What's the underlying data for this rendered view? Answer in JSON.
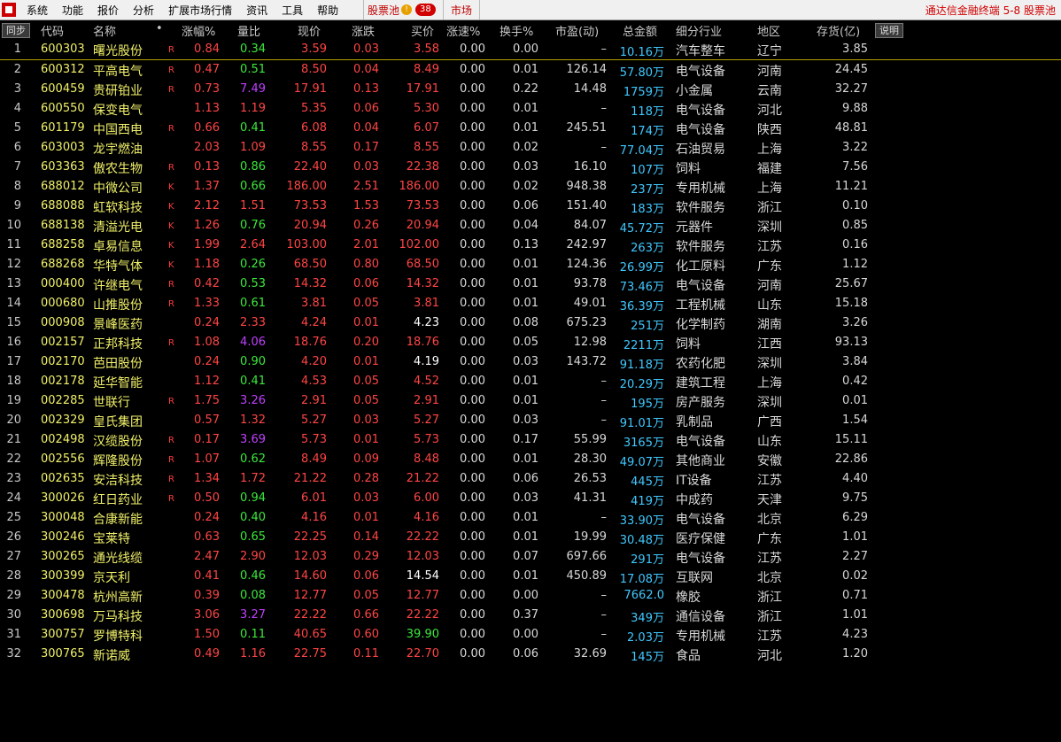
{
  "menubar": {
    "items": [
      "系统",
      "功能",
      "报价",
      "分析",
      "扩展市场行情",
      "资讯",
      "工具",
      "帮助"
    ],
    "pool_label": "股票池",
    "pool_badge": "38",
    "market_label": "市场",
    "title_right": "通达信金融终端  5-8 股票池"
  },
  "header": {
    "sync": "同步",
    "desc": "说明",
    "columns": {
      "code": "代码",
      "name": "名称",
      "dot": "•",
      "pct": "涨幅%",
      "vr": "量比",
      "price": "现价",
      "chg": "涨跌",
      "bid": "买价",
      "spd": "涨速%",
      "turn": "换手%",
      "pe": "市盈(动)",
      "amt": "总金额",
      "ind": "细分行业",
      "reg": "地区",
      "inv": "存货(亿)"
    }
  },
  "colors": {
    "red": "#ff4545",
    "green": "#3ce83c",
    "purple": "#c040ff",
    "white": "#ffffff",
    "yellow": "#f0f06a",
    "cyan": "#40c8ff"
  },
  "rows": [
    {
      "idx": "1",
      "code": "600303",
      "name": "曙光股份",
      "flag": "R",
      "pct": "0.84",
      "vr": "0.34",
      "vrc": "green",
      "price": "3.59",
      "chg": "0.03",
      "bid": "3.58",
      "bidc": "red",
      "spd": "0.00",
      "turn": "0.00",
      "pe": "–",
      "amt": "10.16",
      "unit": "万",
      "ind": "汽车整车",
      "reg": "辽宁",
      "inv": "3.85"
    },
    {
      "idx": "2",
      "code": "600312",
      "name": "平高电气",
      "flag": "R",
      "pct": "0.47",
      "vr": "0.51",
      "vrc": "green",
      "price": "8.50",
      "chg": "0.04",
      "bid": "8.49",
      "bidc": "red",
      "spd": "0.00",
      "turn": "0.01",
      "pe": "126.14",
      "amt": "57.80",
      "unit": "万",
      "ind": "电气设备",
      "reg": "河南",
      "inv": "24.45"
    },
    {
      "idx": "3",
      "code": "600459",
      "name": "贵研铂业",
      "flag": "R",
      "pct": "0.73",
      "vr": "7.49",
      "vrc": "purple",
      "price": "17.91",
      "chg": "0.13",
      "bid": "17.91",
      "bidc": "red",
      "spd": "0.00",
      "turn": "0.22",
      "pe": "14.48",
      "amt": "1759",
      "unit": "万",
      "ind": "小金属",
      "reg": "云南",
      "inv": "32.27"
    },
    {
      "idx": "4",
      "code": "600550",
      "name": "保变电气",
      "flag": "",
      "pct": "1.13",
      "vr": "1.19",
      "vrc": "red",
      "price": "5.35",
      "chg": "0.06",
      "bid": "5.30",
      "bidc": "red",
      "spd": "0.00",
      "turn": "0.01",
      "pe": "–",
      "amt": "118",
      "unit": "万",
      "ind": "电气设备",
      "reg": "河北",
      "inv": "9.88"
    },
    {
      "idx": "5",
      "code": "601179",
      "name": "中国西电",
      "flag": "R",
      "pct": "0.66",
      "vr": "0.41",
      "vrc": "green",
      "price": "6.08",
      "chg": "0.04",
      "bid": "6.07",
      "bidc": "red",
      "spd": "0.00",
      "turn": "0.01",
      "pe": "245.51",
      "amt": "174",
      "unit": "万",
      "ind": "电气设备",
      "reg": "陕西",
      "inv": "48.81"
    },
    {
      "idx": "6",
      "code": "603003",
      "name": "龙宇燃油",
      "flag": "",
      "pct": "2.03",
      "vr": "1.09",
      "vrc": "red",
      "price": "8.55",
      "chg": "0.17",
      "bid": "8.55",
      "bidc": "red",
      "spd": "0.00",
      "turn": "0.02",
      "pe": "–",
      "amt": "77.04",
      "unit": "万",
      "ind": "石油贸易",
      "reg": "上海",
      "inv": "3.22"
    },
    {
      "idx": "7",
      "code": "603363",
      "name": "傲农生物",
      "flag": "R",
      "pct": "0.13",
      "vr": "0.86",
      "vrc": "green",
      "price": "22.40",
      "chg": "0.03",
      "bid": "22.38",
      "bidc": "red",
      "spd": "0.00",
      "turn": "0.03",
      "pe": "16.10",
      "amt": "107",
      "unit": "万",
      "ind": "饲料",
      "reg": "福建",
      "inv": "7.56"
    },
    {
      "idx": "8",
      "code": "688012",
      "name": "中微公司",
      "flag": "K",
      "pct": "1.37",
      "vr": "0.66",
      "vrc": "green",
      "price": "186.00",
      "chg": "2.51",
      "bid": "186.00",
      "bidc": "red",
      "spd": "0.00",
      "turn": "0.02",
      "pe": "948.38",
      "amt": "237",
      "unit": "万",
      "ind": "专用机械",
      "reg": "上海",
      "inv": "11.21"
    },
    {
      "idx": "9",
      "code": "688088",
      "name": "虹软科技",
      "flag": "K",
      "pct": "2.12",
      "vr": "1.51",
      "vrc": "red",
      "price": "73.53",
      "chg": "1.53",
      "bid": "73.53",
      "bidc": "red",
      "spd": "0.00",
      "turn": "0.06",
      "pe": "151.40",
      "amt": "183",
      "unit": "万",
      "ind": "软件服务",
      "reg": "浙江",
      "inv": "0.10"
    },
    {
      "idx": "10",
      "code": "688138",
      "name": "清溢光电",
      "flag": "K",
      "pct": "1.26",
      "vr": "0.76",
      "vrc": "green",
      "price": "20.94",
      "chg": "0.26",
      "bid": "20.94",
      "bidc": "red",
      "spd": "0.00",
      "turn": "0.04",
      "pe": "84.07",
      "amt": "45.72",
      "unit": "万",
      "ind": "元器件",
      "reg": "深圳",
      "inv": "0.85"
    },
    {
      "idx": "11",
      "code": "688258",
      "name": "卓易信息",
      "flag": "K",
      "pct": "1.99",
      "vr": "2.64",
      "vrc": "red",
      "price": "103.00",
      "chg": "2.01",
      "bid": "102.00",
      "bidc": "red",
      "spd": "0.00",
      "turn": "0.13",
      "pe": "242.97",
      "amt": "263",
      "unit": "万",
      "ind": "软件服务",
      "reg": "江苏",
      "inv": "0.16"
    },
    {
      "idx": "12",
      "code": "688268",
      "name": "华特气体",
      "flag": "K",
      "pct": "1.18",
      "vr": "0.26",
      "vrc": "green",
      "price": "68.50",
      "chg": "0.80",
      "bid": "68.50",
      "bidc": "red",
      "spd": "0.00",
      "turn": "0.01",
      "pe": "124.36",
      "amt": "26.99",
      "unit": "万",
      "ind": "化工原料",
      "reg": "广东",
      "inv": "1.12"
    },
    {
      "idx": "13",
      "code": "000400",
      "name": "许继电气",
      "flag": "R",
      "pct": "0.42",
      "vr": "0.53",
      "vrc": "green",
      "price": "14.32",
      "chg": "0.06",
      "bid": "14.32",
      "bidc": "red",
      "spd": "0.00",
      "turn": "0.01",
      "pe": "93.78",
      "amt": "73.46",
      "unit": "万",
      "ind": "电气设备",
      "reg": "河南",
      "inv": "25.67"
    },
    {
      "idx": "14",
      "code": "000680",
      "name": "山推股份",
      "flag": "R",
      "pct": "1.33",
      "vr": "0.61",
      "vrc": "green",
      "price": "3.81",
      "chg": "0.05",
      "bid": "3.81",
      "bidc": "red",
      "spd": "0.00",
      "turn": "0.01",
      "pe": "49.01",
      "amt": "36.39",
      "unit": "万",
      "ind": "工程机械",
      "reg": "山东",
      "inv": "15.18"
    },
    {
      "idx": "15",
      "code": "000908",
      "name": "景峰医药",
      "flag": "",
      "pct": "0.24",
      "vr": "2.33",
      "vrc": "red",
      "price": "4.24",
      "chg": "0.01",
      "bid": "4.23",
      "bidc": "white",
      "spd": "0.00",
      "turn": "0.08",
      "pe": "675.23",
      "amt": "251",
      "unit": "万",
      "ind": "化学制药",
      "reg": "湖南",
      "inv": "3.26"
    },
    {
      "idx": "16",
      "code": "002157",
      "name": "正邦科技",
      "flag": "R",
      "pct": "1.08",
      "vr": "4.06",
      "vrc": "purple",
      "price": "18.76",
      "chg": "0.20",
      "bid": "18.76",
      "bidc": "red",
      "spd": "0.00",
      "turn": "0.05",
      "pe": "12.98",
      "amt": "2211",
      "unit": "万",
      "ind": "饲料",
      "reg": "江西",
      "inv": "93.13"
    },
    {
      "idx": "17",
      "code": "002170",
      "name": "芭田股份",
      "flag": "",
      "pct": "0.24",
      "vr": "0.90",
      "vrc": "green",
      "price": "4.20",
      "chg": "0.01",
      "bid": "4.19",
      "bidc": "white",
      "spd": "0.00",
      "turn": "0.03",
      "pe": "143.72",
      "amt": "91.18",
      "unit": "万",
      "ind": "农药化肥",
      "reg": "深圳",
      "inv": "3.84"
    },
    {
      "idx": "18",
      "code": "002178",
      "name": "延华智能",
      "flag": "",
      "pct": "1.12",
      "vr": "0.41",
      "vrc": "green",
      "price": "4.53",
      "chg": "0.05",
      "bid": "4.52",
      "bidc": "red",
      "spd": "0.00",
      "turn": "0.01",
      "pe": "–",
      "amt": "20.29",
      "unit": "万",
      "ind": "建筑工程",
      "reg": "上海",
      "inv": "0.42"
    },
    {
      "idx": "19",
      "code": "002285",
      "name": "世联行",
      "flag": "R",
      "pct": "1.75",
      "vr": "3.26",
      "vrc": "purple",
      "price": "2.91",
      "chg": "0.05",
      "bid": "2.91",
      "bidc": "red",
      "spd": "0.00",
      "turn": "0.01",
      "pe": "–",
      "amt": "195",
      "unit": "万",
      "ind": "房产服务",
      "reg": "深圳",
      "inv": "0.01"
    },
    {
      "idx": "20",
      "code": "002329",
      "name": "皇氏集团",
      "flag": "",
      "pct": "0.57",
      "vr": "1.32",
      "vrc": "red",
      "price": "5.27",
      "chg": "0.03",
      "bid": "5.27",
      "bidc": "red",
      "spd": "0.00",
      "turn": "0.03",
      "pe": "–",
      "amt": "91.01",
      "unit": "万",
      "ind": "乳制品",
      "reg": "广西",
      "inv": "1.54"
    },
    {
      "idx": "21",
      "code": "002498",
      "name": "汉缆股份",
      "flag": "R",
      "pct": "0.17",
      "vr": "3.69",
      "vrc": "purple",
      "price": "5.73",
      "chg": "0.01",
      "bid": "5.73",
      "bidc": "red",
      "spd": "0.00",
      "turn": "0.17",
      "pe": "55.99",
      "amt": "3165",
      "unit": "万",
      "ind": "电气设备",
      "reg": "山东",
      "inv": "15.11"
    },
    {
      "idx": "22",
      "code": "002556",
      "name": "辉隆股份",
      "flag": "R",
      "pct": "1.07",
      "vr": "0.62",
      "vrc": "green",
      "price": "8.49",
      "chg": "0.09",
      "bid": "8.48",
      "bidc": "red",
      "spd": "0.00",
      "turn": "0.01",
      "pe": "28.30",
      "amt": "49.07",
      "unit": "万",
      "ind": "其他商业",
      "reg": "安徽",
      "inv": "22.86"
    },
    {
      "idx": "23",
      "code": "002635",
      "name": "安洁科技",
      "flag": "R",
      "pct": "1.34",
      "vr": "1.72",
      "vrc": "red",
      "price": "21.22",
      "chg": "0.28",
      "bid": "21.22",
      "bidc": "red",
      "spd": "0.00",
      "turn": "0.06",
      "pe": "26.53",
      "amt": "445",
      "unit": "万",
      "ind": "IT设备",
      "reg": "江苏",
      "inv": "4.40"
    },
    {
      "idx": "24",
      "code": "300026",
      "name": "红日药业",
      "flag": "R",
      "pct": "0.50",
      "vr": "0.94",
      "vrc": "green",
      "price": "6.01",
      "chg": "0.03",
      "bid": "6.00",
      "bidc": "red",
      "spd": "0.00",
      "turn": "0.03",
      "pe": "41.31",
      "amt": "419",
      "unit": "万",
      "ind": "中成药",
      "reg": "天津",
      "inv": "9.75"
    },
    {
      "idx": "25",
      "code": "300048",
      "name": "合康新能",
      "flag": "",
      "pct": "0.24",
      "vr": "0.40",
      "vrc": "green",
      "price": "4.16",
      "chg": "0.01",
      "bid": "4.16",
      "bidc": "red",
      "spd": "0.00",
      "turn": "0.01",
      "pe": "–",
      "amt": "33.90",
      "unit": "万",
      "ind": "电气设备",
      "reg": "北京",
      "inv": "6.29"
    },
    {
      "idx": "26",
      "code": "300246",
      "name": "宝莱特",
      "flag": "",
      "pct": "0.63",
      "vr": "0.65",
      "vrc": "green",
      "price": "22.25",
      "chg": "0.14",
      "bid": "22.22",
      "bidc": "red",
      "spd": "0.00",
      "turn": "0.01",
      "pe": "19.99",
      "amt": "30.48",
      "unit": "万",
      "ind": "医疗保健",
      "reg": "广东",
      "inv": "1.01"
    },
    {
      "idx": "27",
      "code": "300265",
      "name": "通光线缆",
      "flag": "",
      "pct": "2.47",
      "vr": "2.90",
      "vrc": "red",
      "price": "12.03",
      "chg": "0.29",
      "bid": "12.03",
      "bidc": "red",
      "spd": "0.00",
      "turn": "0.07",
      "pe": "697.66",
      "amt": "291",
      "unit": "万",
      "ind": "电气设备",
      "reg": "江苏",
      "inv": "2.27"
    },
    {
      "idx": "28",
      "code": "300399",
      "name": "京天利",
      "flag": "",
      "pct": "0.41",
      "vr": "0.46",
      "vrc": "green",
      "price": "14.60",
      "chg": "0.06",
      "bid": "14.54",
      "bidc": "white",
      "spd": "0.00",
      "turn": "0.01",
      "pe": "450.89",
      "amt": "17.08",
      "unit": "万",
      "ind": "互联网",
      "reg": "北京",
      "inv": "0.02"
    },
    {
      "idx": "29",
      "code": "300478",
      "name": "杭州高新",
      "flag": "",
      "pct": "0.39",
      "vr": "0.08",
      "vrc": "green",
      "price": "12.77",
      "chg": "0.05",
      "bid": "12.77",
      "bidc": "red",
      "spd": "0.00",
      "turn": "0.00",
      "pe": "–",
      "amt": "7662.0",
      "unit": "",
      "ind": "橡胶",
      "reg": "浙江",
      "inv": "0.71"
    },
    {
      "idx": "30",
      "code": "300698",
      "name": "万马科技",
      "flag": "",
      "pct": "3.06",
      "vr": "3.27",
      "vrc": "purple",
      "price": "22.22",
      "chg": "0.66",
      "bid": "22.22",
      "bidc": "red",
      "spd": "0.00",
      "turn": "0.37",
      "pe": "–",
      "amt": "349",
      "unit": "万",
      "ind": "通信设备",
      "reg": "浙江",
      "inv": "1.01"
    },
    {
      "idx": "31",
      "code": "300757",
      "name": "罗博特科",
      "flag": "",
      "pct": "1.50",
      "vr": "0.11",
      "vrc": "green",
      "price": "40.65",
      "chg": "0.60",
      "bid": "39.90",
      "bidc": "green",
      "spd": "0.00",
      "turn": "0.00",
      "pe": "–",
      "amt": "2.03",
      "unit": "万",
      "ind": "专用机械",
      "reg": "江苏",
      "inv": "4.23"
    },
    {
      "idx": "32",
      "code": "300765",
      "name": "新诺威",
      "flag": "",
      "pct": "0.49",
      "vr": "1.16",
      "vrc": "red",
      "price": "22.75",
      "chg": "0.11",
      "bid": "22.70",
      "bidc": "red",
      "spd": "0.00",
      "turn": "0.06",
      "pe": "32.69",
      "amt": "145",
      "unit": "万",
      "ind": "食品",
      "reg": "河北",
      "inv": "1.20"
    }
  ]
}
